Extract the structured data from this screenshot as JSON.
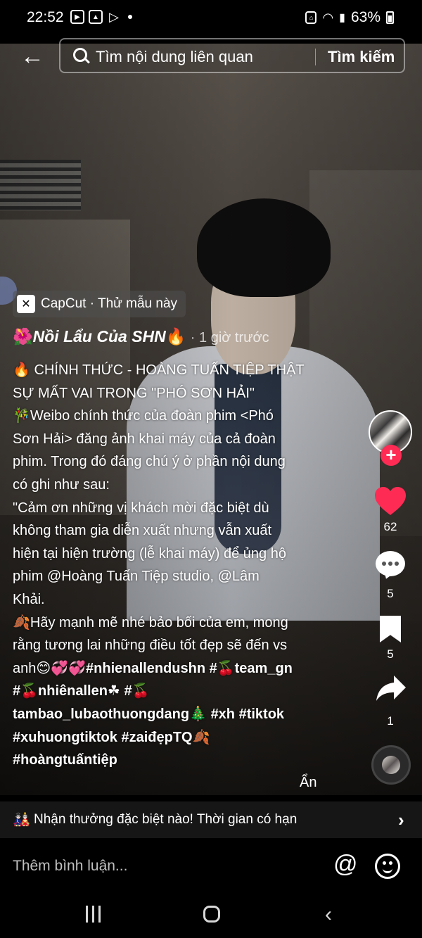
{
  "status": {
    "time": "22:52",
    "battery": "63%"
  },
  "search": {
    "placeholder": "Tìm nội dung liên quan",
    "button": "Tìm kiếm"
  },
  "capcut": {
    "label": "CapCut · Thử mẫu này"
  },
  "author": {
    "prefix": "🌺",
    "name": "Nồi Lẩu Của SHN",
    "suffix": "🔥",
    "time": "· 1 giờ trước"
  },
  "caption": {
    "lines": [
      "🔥 CHÍNH THỨC - HOÀNG TUẤN TIỆP THẬT",
      "SỰ MẤT VAI TRONG \"PHÓ SƠN HẢI\"",
      "🎋Weibo chính thức của đoàn phim <Phó",
      "Sơn Hải> đăng ảnh khai máy của cả đoàn",
      "phim. Trong đó đáng chú ý ở phần nội dung",
      "có ghi như sau:",
      "\"Cảm ơn những vị khách mời đặc biệt dù",
      "không tham gia diễn xuất nhưng vẫn xuất",
      "hiện tại hiện trường (lễ khai máy) để ủng hộ",
      "phim @Hoàng Tuấn Tiệp studio, @Lâm",
      "Khải.",
      "🍂Hãy mạnh mẽ nhé bảo bối của em, mong",
      "rằng tương lai những điều tốt đẹp sẽ đến vs"
    ],
    "tag_lines": [
      [
        "anh😊💞💞",
        "#nhienallendushn",
        " ",
        "#🍒team_gn"
      ],
      [
        "#🍒nhiênallen☘",
        " ",
        "#🍒"
      ],
      [
        "tambao_lubaothuongdang🎄",
        " ",
        "#xh",
        " ",
        "#tiktok"
      ],
      [
        "#xuhuongtiktok",
        " ",
        "#zaiđẹpTQ🍂"
      ],
      [
        "#hoàngtuấntiệp"
      ]
    ],
    "hide": "Ẩn"
  },
  "rail": {
    "likes": "62",
    "comments": "5",
    "saves": "5",
    "shares": "1",
    "like_color": "#fe2c55"
  },
  "promo": {
    "icon": "🎎",
    "text": "Nhận thưởng đặc biệt nào! Thời gian có hạn",
    "chevron": "›"
  },
  "comment": {
    "placeholder": "Thêm bình luận...",
    "at": "@"
  }
}
